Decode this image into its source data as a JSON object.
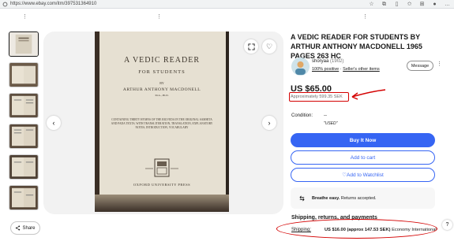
{
  "browser": {
    "url": "https://www.ebay.com/itm/397531364910"
  },
  "gallery": {
    "thumbnail_count": 6,
    "selected_index": 0
  },
  "book_cover": {
    "title_line1": "A VEDIC READER",
    "title_line2": "FOR STUDENTS",
    "by": "BY",
    "author": "ARTHUR ANTHONY MACDONELL",
    "author_note": "M.A., Ph.D.",
    "blurb": "CONTAINING THIRTY HYMNS OF THE RIGVEDA IN THE ORIGINAL SAMHITA AND PADA TEXTS, WITH TRANSLITERATION, TRANSLATION, EXPLANATORY NOTES, INTRODUCTION, VOCABULARY",
    "publisher": "OXFORD UNIVERSITY PRESS"
  },
  "share": {
    "label": "Share"
  },
  "listing": {
    "title": "A VEDIC READER FOR STUDENTS BY ARTHUR ANTHONY MACDONELL 1965 PAGES 263 HC",
    "price": "US $65.00",
    "approx_price": "Approximately 599.35 SEK",
    "condition_label": "Condition:",
    "condition_value": "--",
    "condition_note": "\"USED\""
  },
  "seller": {
    "name": "shoryaa",
    "feedback": "(1902)",
    "positive": "100% positive",
    "other_items": "Seller's other items",
    "message_label": "Message"
  },
  "actions": {
    "buy_now": "Buy It Now",
    "add_to_cart": "Add to cart",
    "add_to_watchlist": "Add to Watchlist"
  },
  "breathe": {
    "bold": "Breathe easy.",
    "text": "Returns accepted."
  },
  "shipping": {
    "heading": "Shipping, returns, and payments",
    "label": "Shipping:",
    "value_bold": "US $16.00 (approx 147.53 SEK)",
    "value_rest": "Economy International"
  },
  "help": {
    "label": "?"
  },
  "colors": {
    "accent": "#3665f3",
    "annotation": "#d40000"
  }
}
